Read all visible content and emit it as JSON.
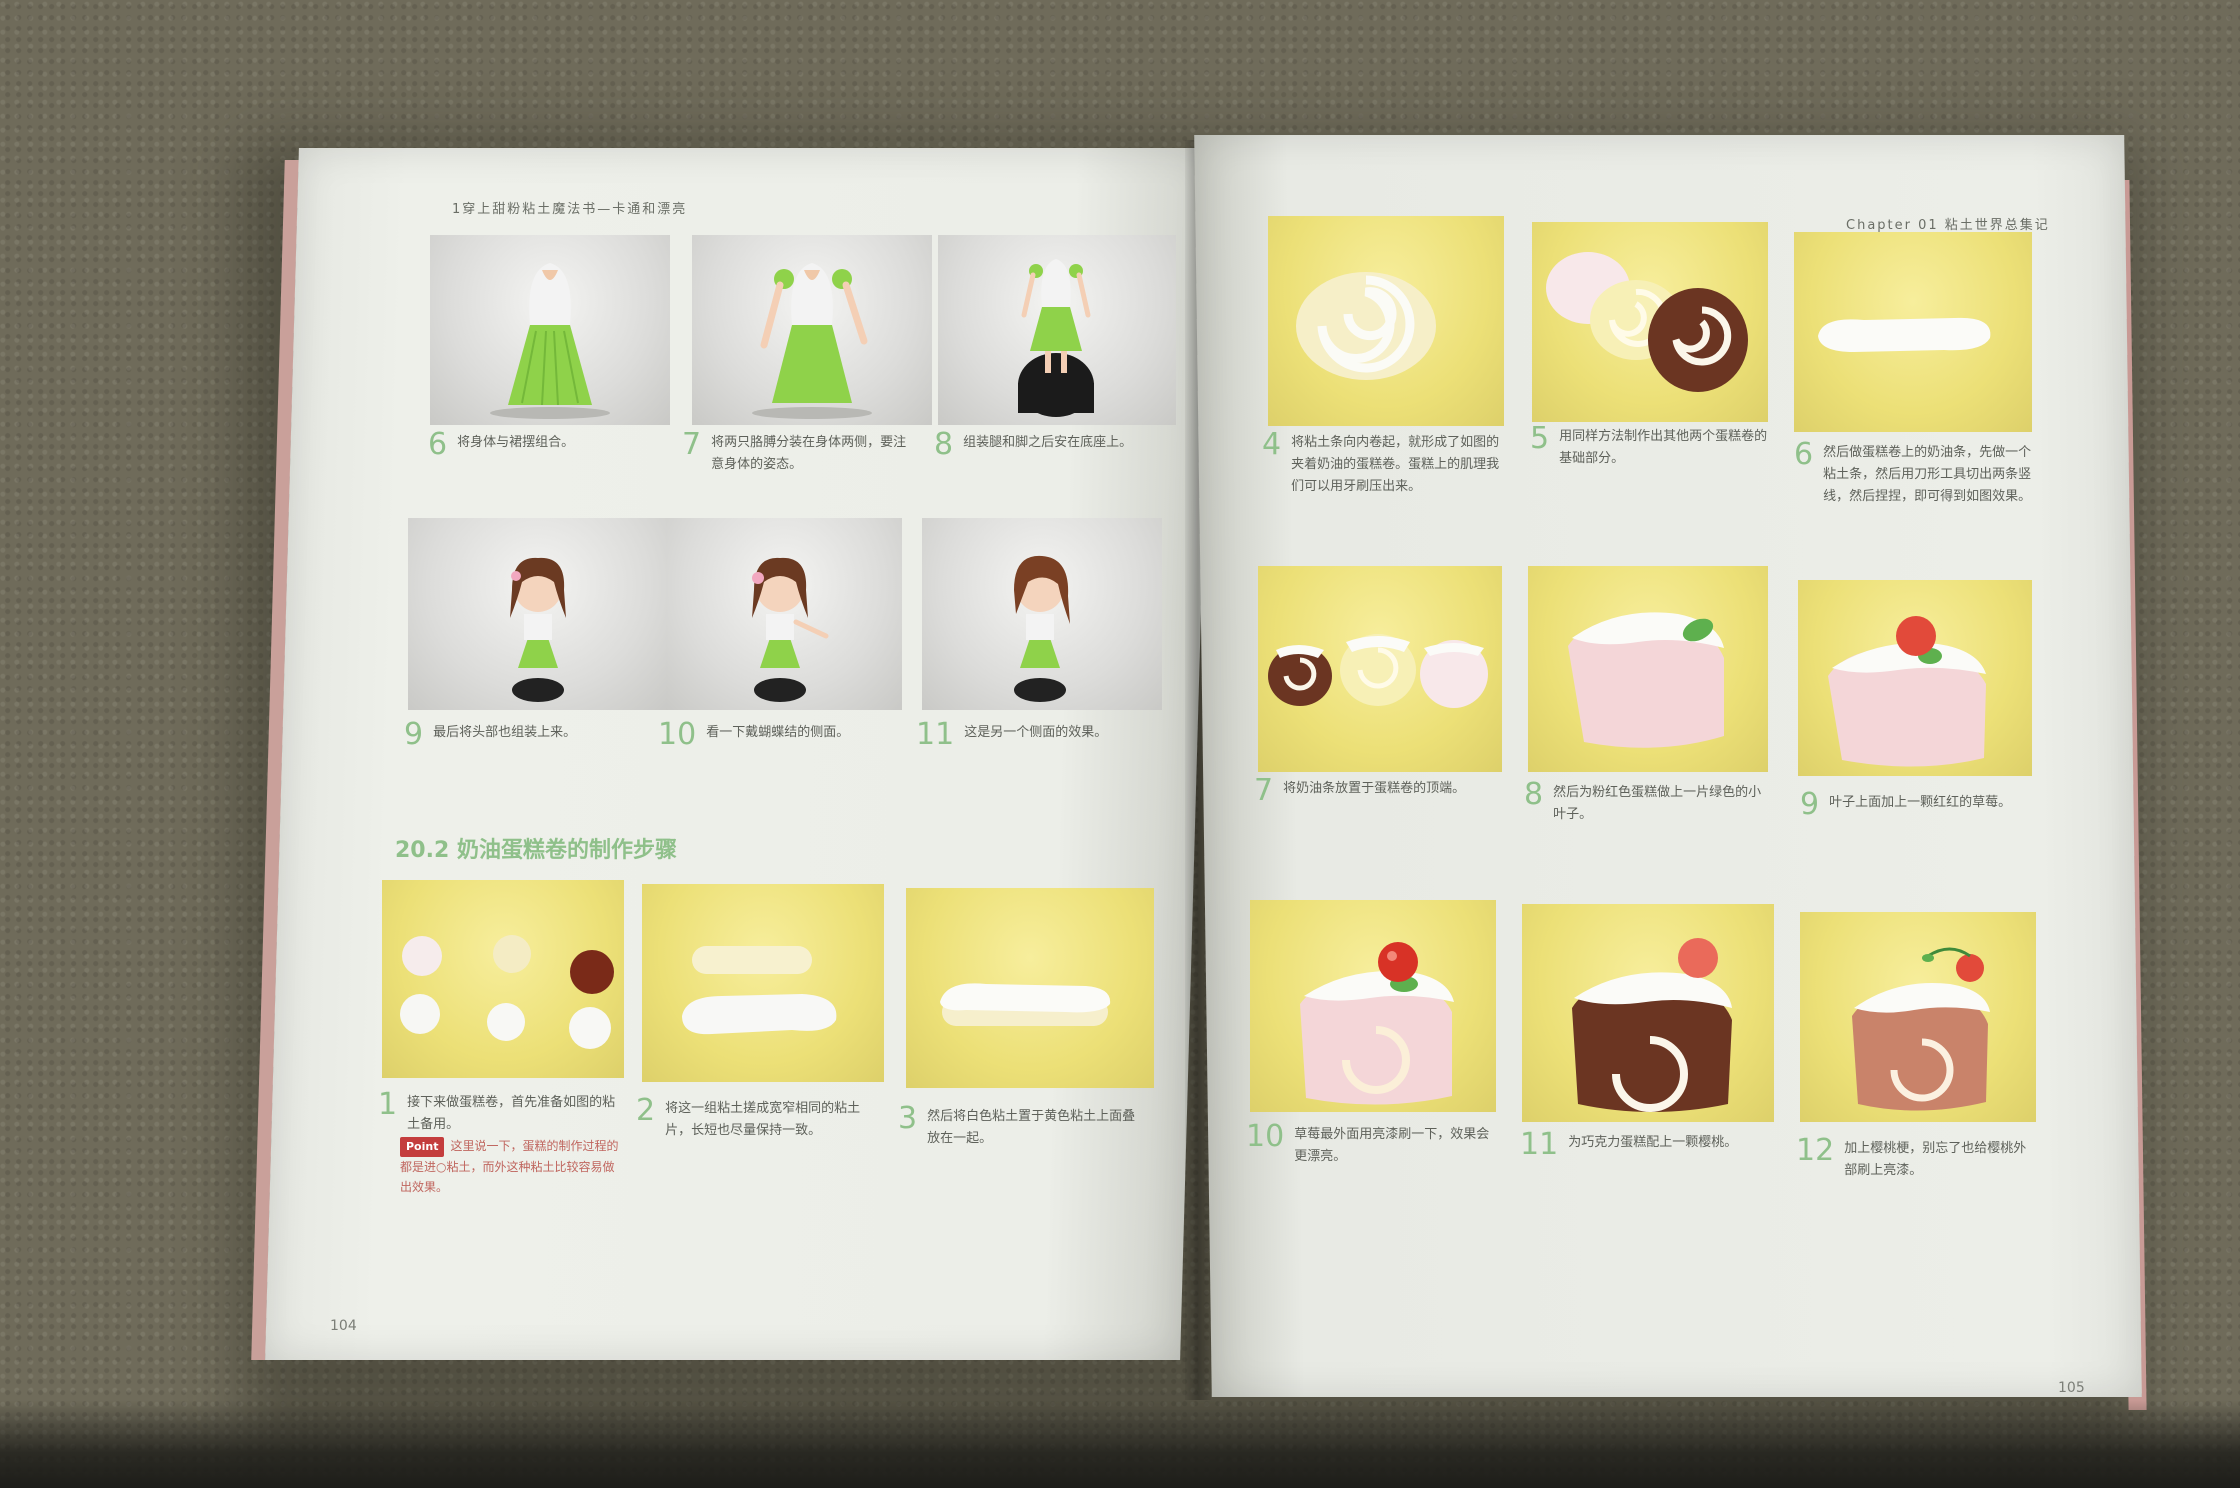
{
  "left_page": {
    "running_head": "1穿上甜粉粘土魔法书—卡通和漂亮",
    "folio": "104",
    "section_title": "20.2 奶油蛋糕卷的制作步骤",
    "figure_steps": [
      {
        "num": "6",
        "text": "将身体与裙摆组合。"
      },
      {
        "num": "7",
        "text": "将两只胳膊分装在身体两侧，要注意身体的姿态。"
      },
      {
        "num": "8",
        "text": "组装腿和脚之后安在底座上。"
      },
      {
        "num": "9",
        "text": "最后将头部也组装上来。"
      },
      {
        "num": "10",
        "text": "看一下戴蝴蝶结的侧面。"
      },
      {
        "num": "11",
        "text": "这是另一个侧面的效果。"
      }
    ],
    "cake_steps": [
      {
        "num": "1",
        "text": "接下来做蛋糕卷，首先准备如图的粘土备用。"
      },
      {
        "num": "2",
        "text": "将这一组粘土搓成宽窄相同的粘土片，长短也尽量保持一致。"
      },
      {
        "num": "3",
        "text": "然后将白色粘土置于黄色粘土上面叠放在一起。"
      }
    ],
    "point_label": "Point",
    "point_text": "这里说一下，蛋糕的制作过程的都是进○粘土，而外这种粘土比较容易做出效果。"
  },
  "right_page": {
    "running_head": "Chapter 01  粘土世界总集记",
    "folio": "105",
    "steps": [
      {
        "num": "4",
        "text": "将粘土条向内卷起，就形成了如图的夹着奶油的蛋糕卷。蛋糕上的肌理我们可以用牙刷压出来。"
      },
      {
        "num": "5",
        "text": "用同样方法制作出其他两个蛋糕卷的基础部分。"
      },
      {
        "num": "6",
        "text": "然后做蛋糕卷上的奶油条，先做一个粘土条，然后用刀形工具切出两条竖线，然后捏捏，即可得到如图效果。"
      },
      {
        "num": "7",
        "text": "将奶油条放置于蛋糕卷的顶端。"
      },
      {
        "num": "8",
        "text": "然后为粉红色蛋糕做上一片绿色的小叶子。"
      },
      {
        "num": "9",
        "text": "叶子上面加上一颗红红的草莓。"
      },
      {
        "num": "10",
        "text": "草莓最外面用亮漆刷一下，效果会更漂亮。"
      },
      {
        "num": "11",
        "text": "为巧克力蛋糕配上一颗樱桃。"
      },
      {
        "num": "12",
        "text": "加上樱桃梗，别忘了也给樱桃外部刷上亮漆。"
      }
    ]
  }
}
